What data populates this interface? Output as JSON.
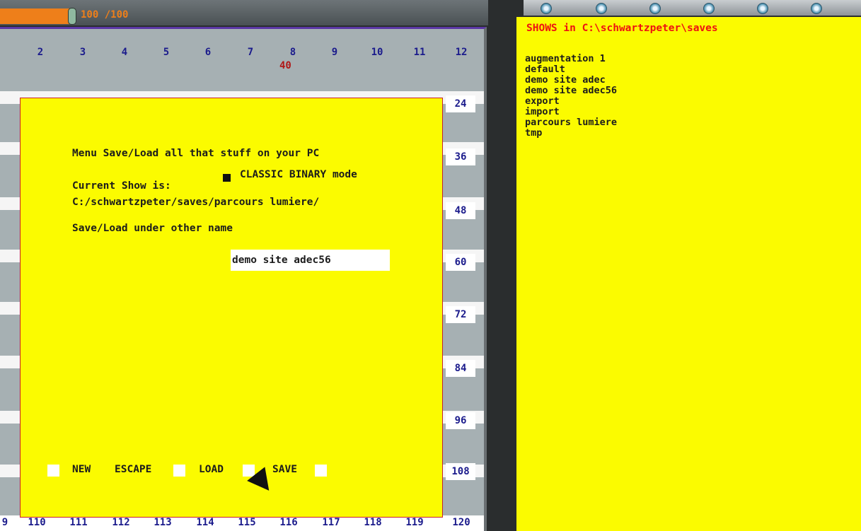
{
  "top": {
    "progress_text": "100 /100",
    "progress_fraction": 1.0
  },
  "grid": {
    "col_numbers": [
      "2",
      "3",
      "4",
      "5",
      "6",
      "7",
      "8",
      "9",
      "10",
      "11",
      "12"
    ],
    "highlight_value": "40",
    "row_numbers": [
      "24",
      "36",
      "48",
      "60",
      "72",
      "84",
      "96",
      "108"
    ],
    "bottom_numbers": [
      "9",
      "110",
      "111",
      "112",
      "113",
      "114",
      "115",
      "116",
      "117",
      "118",
      "119",
      "120"
    ]
  },
  "dialog": {
    "menu_title": "Menu Save/Load all that stuff on your PC",
    "binary_mode_label": "CLASSIC BINARY mode",
    "current_show_label": "Current Show is:",
    "current_show_path": "C:/schwartzpeter/saves/parcours lumiere/",
    "other_name_label": "Save/Load under other name",
    "name_value": "demo site adec56",
    "new_label": "NEW",
    "escape_label": "ESCAPE",
    "load_label": "LOAD",
    "save_label": "SAVE"
  },
  "shows": {
    "title": "SHOWS in C:\\schwartzpeter\\saves",
    "items": [
      "augmentation 1",
      "default",
      "demo site adec",
      "demo site adec56",
      "export",
      "import",
      "parcours lumiere",
      "tmp"
    ]
  }
}
